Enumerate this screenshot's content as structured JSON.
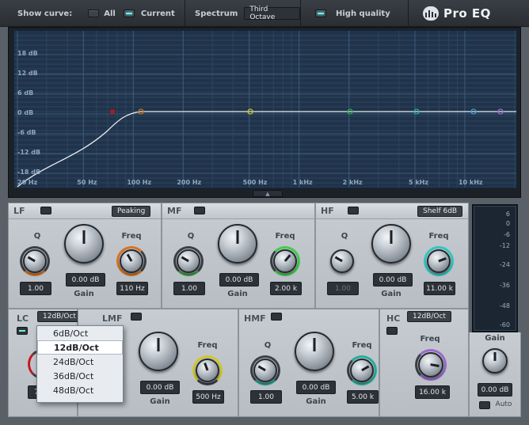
{
  "topbar": {
    "show_curve_label": "Show curve:",
    "all_label": "All",
    "current_label": "Current",
    "spectrum_label": "Spectrum",
    "spectrum_value": "Third Octave",
    "hq_label": "High quality",
    "logo": "Pro EQ"
  },
  "graph": {
    "db_ticks": [
      "18 dB",
      "12 dB",
      "6 dB",
      "0 dB",
      "-6 dB",
      "-12 dB",
      "-18 dB"
    ],
    "hz_ticks": [
      "20 Hz",
      "50 Hz",
      "100 Hz",
      "200 Hz",
      "500 Hz",
      "1 kHz",
      "2 kHz",
      "5 kHz",
      "10 kHz"
    ],
    "node_colors": [
      "#b01818",
      "#c8731e",
      "#c8c21e",
      "#22b040",
      "#20b0a0",
      "#3aa0c8",
      "#a06ac8"
    ]
  },
  "lf": {
    "name": "LF",
    "mode": "Peaking",
    "q_label": "Q",
    "gain_label": "Gain",
    "freq_label": "Freq",
    "q_value": "1.00",
    "gain_value": "0.00 dB",
    "freq_value": "110 Hz"
  },
  "mf": {
    "name": "MF",
    "q_label": "Q",
    "gain_label": "Gain",
    "freq_label": "Freq",
    "q_value": "1.00",
    "gain_value": "0.00 dB",
    "freq_value": "2.00 k"
  },
  "hf": {
    "name": "HF",
    "mode": "Shelf 6dB",
    "q_label": "Q",
    "gain_label": "Gain",
    "freq_label": "Freq",
    "q_value": "1.00",
    "gain_value": "0.00 dB",
    "freq_value": "11.00 k"
  },
  "lc": {
    "name": "LC",
    "slope": "12dB/Oct",
    "partial_value": "7"
  },
  "lmf": {
    "name": "LMF",
    "gain_label": "Gain",
    "freq_label": "Freq",
    "gain_value": "0.00 dB",
    "freq_value": "500 Hz"
  },
  "hmf": {
    "name": "HMF",
    "q_label": "Q",
    "gain_label": "Gain",
    "freq_label": "Freq",
    "q_value": "1.00",
    "gain_value": "0.00 dB",
    "freq_value": "5.00 k"
  },
  "hc": {
    "name": "HC",
    "slope": "12dB/Oct",
    "freq_label": "Freq",
    "freq_value": "16.00 k"
  },
  "output": {
    "meter_ticks": [
      "6",
      "0",
      "-6",
      "-12",
      "-24",
      "-36",
      "-48",
      "-60"
    ],
    "gain_label": "Gain",
    "gain_value": "0.00 dB",
    "auto_label": "Auto"
  },
  "dropdown": {
    "items": [
      "6dB/Oct",
      "12dB/Oct",
      "24dB/Oct",
      "36dB/Oct",
      "48dB/Oct"
    ],
    "selected": "12dB/Oct"
  }
}
